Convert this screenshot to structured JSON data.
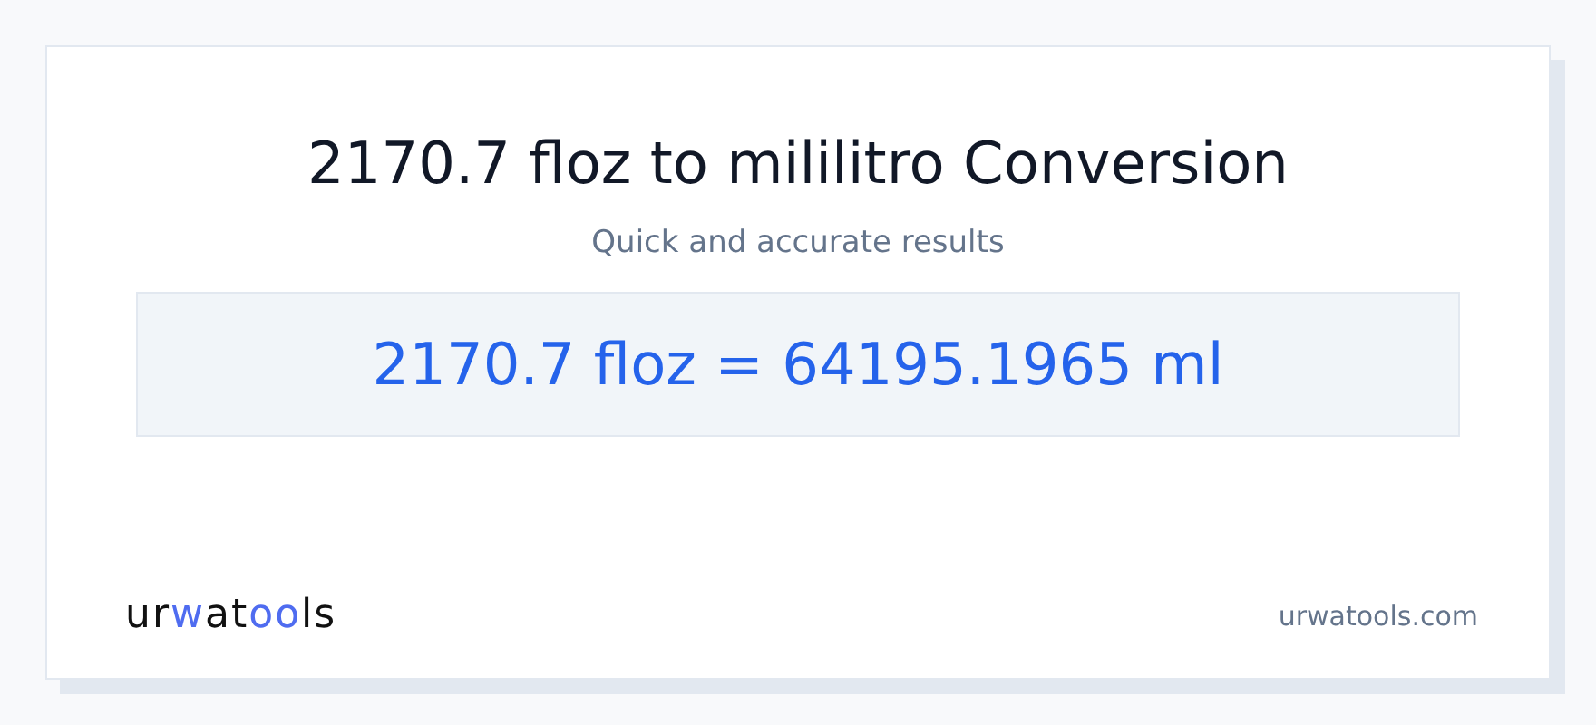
{
  "title": "2170.7 floz to mililitro Conversion",
  "subtitle": "Quick and accurate results",
  "result": "2170.7 floz = 64195.1965 ml",
  "logo": [
    {
      "text": "ur",
      "accent": false
    },
    {
      "text": "w",
      "accent": true
    },
    {
      "text": "at",
      "accent": false
    },
    {
      "text": "oo",
      "accent": true
    },
    {
      "text": "ls",
      "accent": false
    }
  ],
  "site": "urwatools.com"
}
